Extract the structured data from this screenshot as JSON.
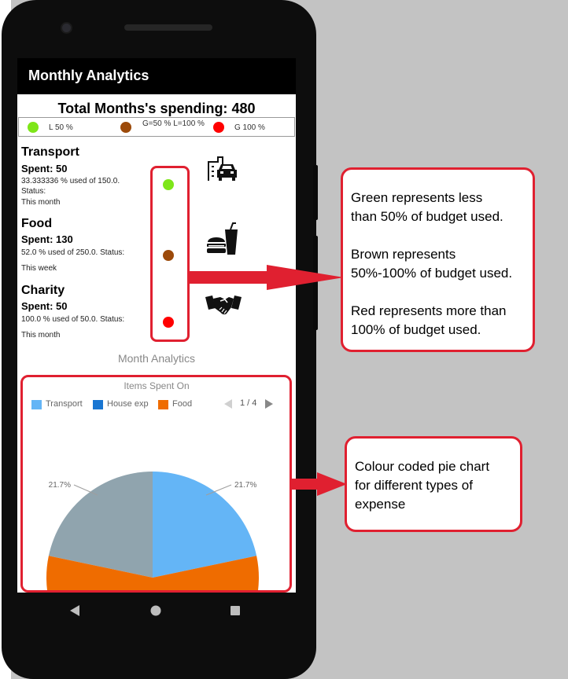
{
  "app": {
    "title": "Monthly Analytics"
  },
  "summary": {
    "total_label": "Total Months's spending:",
    "total_value": "480"
  },
  "legend": {
    "green_label": "L 50 %",
    "brown_label": "G=50 % L=100 %",
    "red_label": "G 100 %",
    "green_color": "#7ee619",
    "brown_color": "#9c4a0a",
    "red_color": "#ff0000"
  },
  "categories": [
    {
      "name": "Transport",
      "spent": "Spent: 50",
      "detail": "33.333336 % used of 150.0.",
      "status": "Status:",
      "period": "This month",
      "status_color": "#7ee619",
      "icon": "transport-icon"
    },
    {
      "name": "Food",
      "spent": "Spent: 130",
      "detail": "52.0 % used of 250.0. Status:",
      "period": "This week",
      "status_color": "#9c4a0a",
      "icon": "food-icon"
    },
    {
      "name": "Charity",
      "spent": "Spent: 50",
      "detail": "100.0 % used of 50.0. Status:",
      "period": "This month",
      "status_color": "#ff0000",
      "icon": "handshake-icon"
    }
  ],
  "analytics": {
    "section_title": "Month Analytics",
    "chart_title": "Items Spent On",
    "pager": "1 / 4"
  },
  "chart_data": {
    "type": "pie",
    "title": "Items Spent On",
    "legend": [
      "Transport",
      "House exp",
      "Food"
    ],
    "legend_colors": [
      "#64b5f6",
      "#1976d2",
      "#ef6c00"
    ],
    "visible_slice_labels": [
      "21.7%",
      "21.7%"
    ],
    "slices": [
      {
        "label": "21.7%",
        "value": 21.7,
        "color": "#64b5f6"
      },
      {
        "label": "21.7%",
        "value": 21.7,
        "color": "#90a4ae"
      },
      {
        "label": "",
        "value": 56.6,
        "color": "#ef6c00"
      }
    ],
    "legend_placement": "top-left"
  },
  "annotations": {
    "status_callout": [
      "Green represents less",
      "than 50% of budget used.",
      "",
      "Brown represents",
      "50%-100% of budget used.",
      "",
      "Red represents more than",
      "100% of budget used."
    ],
    "chart_callout": [
      "Colour coded pie chart",
      "for different types of",
      "expense"
    ],
    "highlight_color": "#e02030"
  }
}
